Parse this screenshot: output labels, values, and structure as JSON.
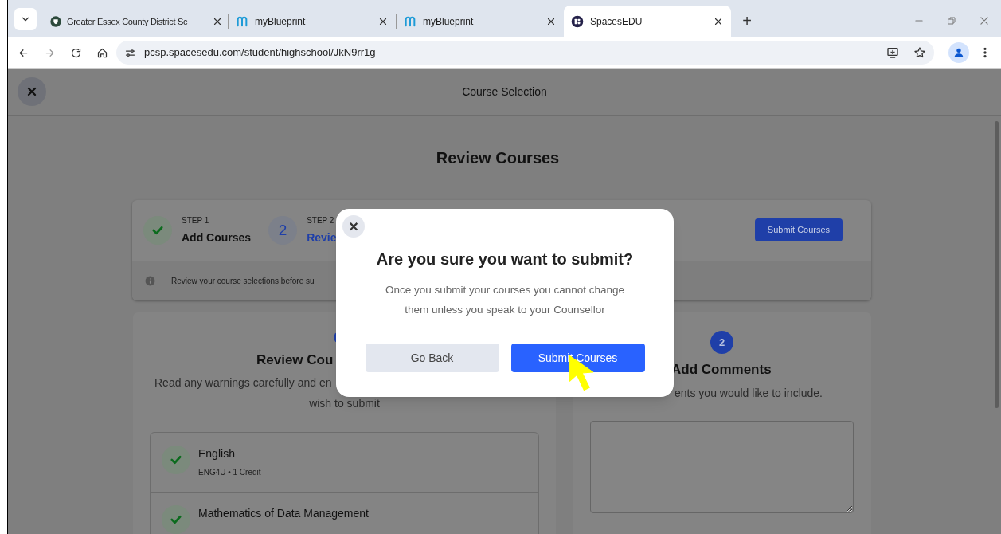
{
  "browser": {
    "tabs": [
      {
        "title": "Greater Essex County District Sc",
        "kind": "crest",
        "selected": false
      },
      {
        "title": "myBlueprint",
        "kind": "arch",
        "selected": false
      },
      {
        "title": "myBlueprint",
        "kind": "arch",
        "selected": false
      },
      {
        "title": "SpacesEDU",
        "kind": "grid",
        "selected": true
      }
    ],
    "new_tab": "+",
    "url": "pcsp.spacesedu.com/student/highschool/JkN9rr1g"
  },
  "header": {
    "title": "Course Selection"
  },
  "page_title": "Review Courses",
  "steps": [
    {
      "step": "STEP 1",
      "label": "Add Courses",
      "done": true
    },
    {
      "step": "STEP 2",
      "label": "Revie",
      "done": false,
      "number": "2"
    }
  ],
  "submit_button": "Submit Courses",
  "info_text": "Review your course selections before su",
  "review_panel": {
    "title": "Review Cou",
    "lines": [
      "Read any warnings carefully and en",
      "wish to submit"
    ],
    "courses": [
      {
        "name": "English",
        "detail": "ENG4U • 1 Credit",
        "ok": true
      },
      {
        "name": "Mathematics of Data Management",
        "ok": true
      }
    ]
  },
  "comments_panel": {
    "number": "2",
    "title": "Add Comments",
    "subtitle": "ents you would like to include."
  },
  "dialog": {
    "close": "×",
    "title": "Are you sure you want to submit?",
    "message": [
      "Once you submit your courses you cannot change",
      "them unless you speak to your Counsellor"
    ],
    "buttons": [
      {
        "label": "Go Back",
        "kind": "secondary"
      },
      {
        "label": "Submit Courses",
        "kind": "primary"
      }
    ]
  }
}
